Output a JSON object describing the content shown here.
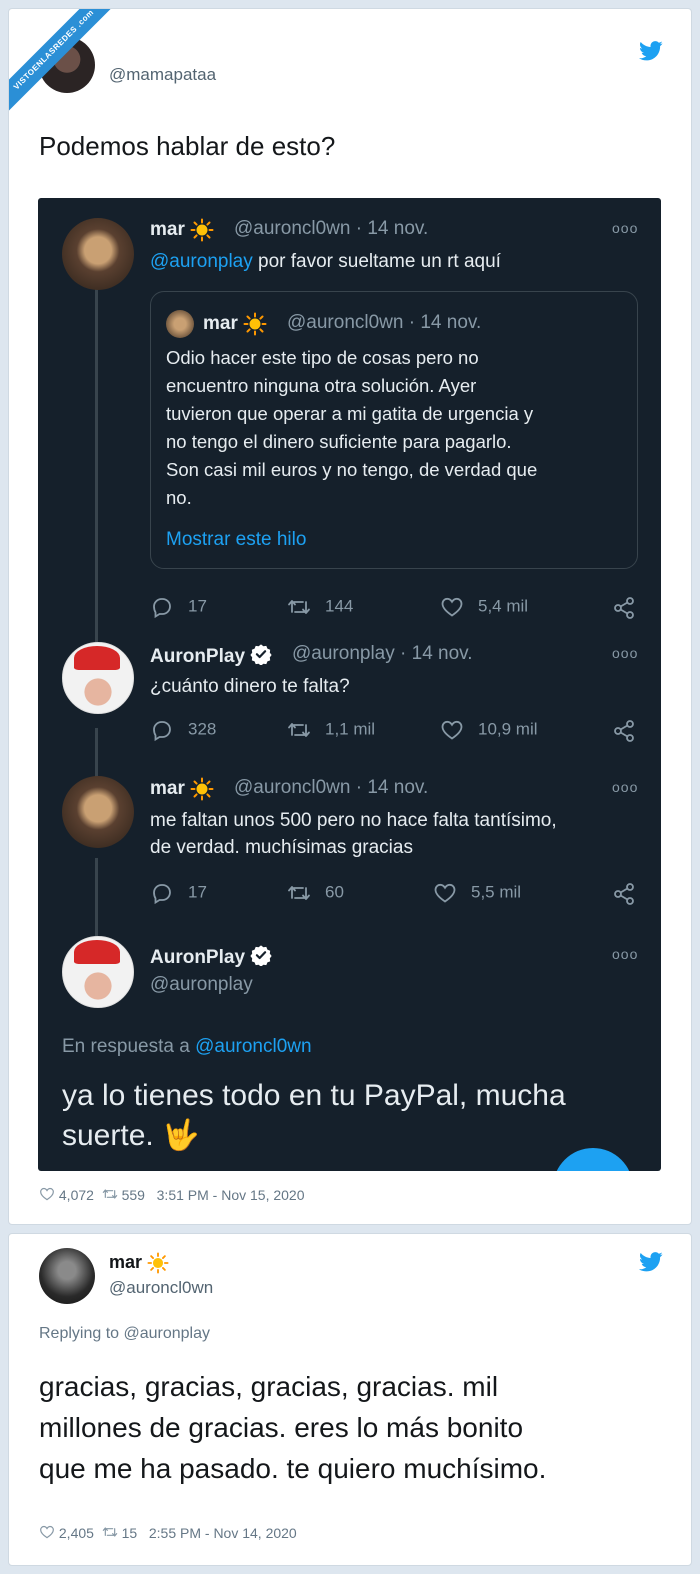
{
  "watermark": "VISTOENLASREDES .com",
  "tweet1": {
    "handle": "@mamapataa",
    "text": "Podemos hablar de esto?",
    "likes": "4,072",
    "retweets": "559",
    "timestamp": "3:51 PM - Nov 15, 2020"
  },
  "screenshot": {
    "t1": {
      "name": "mar",
      "meta": "@auroncl0wn · 14 nov.",
      "mention": "@auronplay",
      "text": " por favor sueltame un rt aquí",
      "quote": {
        "name": "mar",
        "meta": "@auroncl0wn · 14 nov.",
        "lines": [
          "Odio hacer este tipo de cosas pero no",
          "encuentro ninguna otra solución. Ayer",
          "tuvieron que operar a mi gatita de urgencia y",
          "no tengo el dinero suficiente para pagarlo.",
          "Son casi mil euros y no tengo, de verdad que",
          "no."
        ],
        "show_thread": "Mostrar este hilo"
      },
      "replies": "17",
      "retweets": "144",
      "likes": "5,4 mil"
    },
    "t2": {
      "name": "AuronPlay",
      "meta": "@auronplay · 14 nov.",
      "text": "¿cuánto dinero te falta?",
      "replies": "328",
      "retweets": "1,1 mil",
      "likes": "10,9 mil"
    },
    "t3": {
      "name": "mar",
      "meta": "@auroncl0wn · 14 nov.",
      "lines": [
        "me faltan unos 500 pero no hace falta tantísimo,",
        "de verdad. muchísimas gracias"
      ],
      "replies": "17",
      "retweets": "60",
      "likes": "5,5 mil"
    },
    "t4": {
      "name": "AuronPlay",
      "handle": "@auronplay",
      "reply_prefix": "En respuesta a ",
      "reply_to": "@auroncl0wn",
      "lines": [
        "ya lo tienes todo en tu PayPal, mucha",
        "suerte. 🤟"
      ]
    }
  },
  "tweet2": {
    "name": "mar",
    "handle": "@auroncl0wn",
    "replying": "Replying to @auronplay",
    "lines": [
      "gracias, gracias, gracias, gracias. mil",
      "millones de gracias. eres lo más bonito",
      "que me ha pasado. te quiero muchísimo."
    ],
    "likes": "2,405",
    "retweets": "15",
    "timestamp": "2:55 PM - Nov 14, 2020"
  },
  "colors": {
    "twitter_blue": "#1da1f2",
    "dark_bg": "#15202b",
    "watermark": "#2b8fd6"
  },
  "icons": [
    "twitter-bird-icon",
    "sun-emoji-icon",
    "verified-badge-icon",
    "reply-icon",
    "retweet-icon",
    "heart-icon",
    "share-icon",
    "more-dots-icon"
  ]
}
